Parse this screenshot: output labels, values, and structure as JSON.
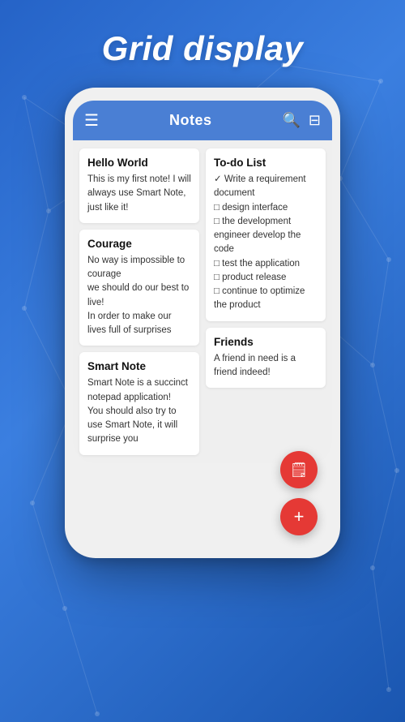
{
  "page": {
    "title": "Grid display",
    "background_colors": [
      "#2563c7",
      "#3b7fe0",
      "#1a56b0"
    ]
  },
  "app": {
    "header": {
      "menu_icon": "☰",
      "title": "Notes",
      "search_icon": "🔍",
      "filter_icon": "⊟"
    },
    "notes": [
      {
        "id": "hello-world",
        "title": "Hello World",
        "body": "This is my first note! I will always use Smart Note, just like it!",
        "column": 0
      },
      {
        "id": "todo-list",
        "title": "To-do List",
        "body": "✓ Write a requirement document\n□ design interface\n□ the development engineer develop the code\n□ test the application\n□ product release\n□ continue to optimize the product",
        "column": 1
      },
      {
        "id": "courage",
        "title": "Courage",
        "body": "No way is impossible to courage\nwe should do our best to live!\nIn order to make our lives full of surprises",
        "column": 0
      },
      {
        "id": "friends",
        "title": "Friends",
        "body": "A friend in need is a friend indeed!",
        "column": 1
      },
      {
        "id": "smart-note",
        "title": "Smart Note",
        "body": "Smart Note is a succinct notepad application!\nYou should also try to use Smart Note, it will surprise you",
        "column": 0
      }
    ],
    "fab_buttons": [
      {
        "id": "fab-document",
        "icon": "📄"
      },
      {
        "id": "fab-add",
        "icon": "+"
      }
    ]
  }
}
